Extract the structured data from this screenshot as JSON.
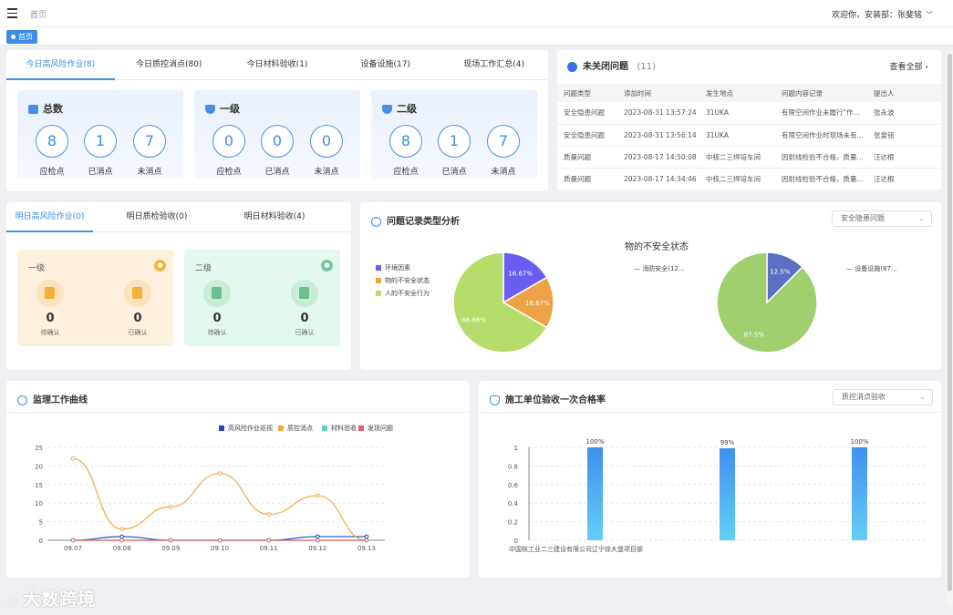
{
  "header": {
    "breadcrumb": "首页",
    "welcome": "欢迎你，安装部：张斐铭",
    "chevron": "﹀"
  },
  "tagbar": {
    "tag": "首页"
  },
  "today": {
    "tabs": [
      "今日高风险作业(8)",
      "今日质控消点(80)",
      "今日材料验收(1)",
      "设备设施(17)",
      "现场工作汇总(4)"
    ],
    "boxes": [
      {
        "title": "总数",
        "items": [
          {
            "value": "8",
            "label": "应检点"
          },
          {
            "value": "1",
            "label": "已消点"
          },
          {
            "value": "7",
            "label": "未消点"
          }
        ]
      },
      {
        "title": "一级",
        "items": [
          {
            "value": "0",
            "label": "应检点"
          },
          {
            "value": "0",
            "label": "已消点"
          },
          {
            "value": "0",
            "label": "未消点"
          }
        ]
      },
      {
        "title": "二级",
        "items": [
          {
            "value": "8",
            "label": "应检点"
          },
          {
            "value": "1",
            "label": "已消点"
          },
          {
            "value": "7",
            "label": "未消点"
          }
        ]
      }
    ]
  },
  "issues": {
    "title": "未关闭问题",
    "count": "(11)",
    "view_all": "查看全部",
    "view_all_arrow": "›",
    "columns": [
      "问题类型",
      "添加时间",
      "发生地点",
      "问题内容记录",
      "提出人"
    ],
    "rows": [
      [
        "安全隐患问题",
        "2023-08-31 13:57:24",
        "31UKA",
        "有限空间作业未履行\"作...",
        "张永波"
      ],
      [
        "安全隐患问题",
        "2023-08-31 13:56:14",
        "31UKA",
        "有限空间作业时现场未有...",
        "张斐铭"
      ],
      [
        "质量问题",
        "2023-08-17 14:50:08",
        "中核二三焊培车间",
        "因射线检验不合格，质量...",
        "汪达根"
      ],
      [
        "质量问题",
        "2023-08-17 14:34:46",
        "中核二三焊培车间",
        "因射线检验不合格，质量...",
        "汪达根"
      ]
    ]
  },
  "tomorrow": {
    "tabs": [
      "明日高风险作业(0)",
      "明日质检验收(0)",
      "明日材料验收(4)"
    ],
    "boxes": [
      {
        "title": "一级",
        "items": [
          {
            "value": "0",
            "label": "待确认"
          },
          {
            "value": "0",
            "label": "已确认"
          }
        ]
      },
      {
        "title": "二级",
        "items": [
          {
            "value": "0",
            "label": "待确认"
          },
          {
            "value": "0",
            "label": "已确认"
          }
        ]
      }
    ]
  },
  "issue_types": {
    "title": "问题记录类型分析",
    "select": "安全隐患问题",
    "subtitle": "物的不安全状态",
    "legend": [
      "环境因素",
      "物的不安全状态",
      "人的不安全行为"
    ],
    "pie1_labels": [
      "16.67%",
      "16.67%",
      "66.66%"
    ],
    "pie2_legend": [
      "消防安全(12...",
      "设备设施(87..."
    ],
    "pie2_labels": [
      "12.5%",
      "87.5%"
    ],
    "colors": {
      "env": "#6a5ef2",
      "obj": "#eea246",
      "human": "#b6dc6c",
      "fire": "#5b70c2",
      "equip": "#a0cf70"
    }
  },
  "supervision": {
    "title": "监理工作曲线",
    "legend": [
      "高风险作业巡视",
      "质控消点",
      "材料验收",
      "发现问题"
    ],
    "yticks": [
      "25",
      "20",
      "15",
      "10",
      "5",
      "0"
    ],
    "xticks": [
      "09.07",
      "09.08",
      "09.09",
      "09.10",
      "09.11",
      "09.12",
      "09.13"
    ]
  },
  "pass_rate": {
    "title": "施工单位验收一次合格率",
    "select": "质控消点验收",
    "yticks": [
      "1",
      "0.8",
      "0.6",
      "0.4",
      "0.2",
      "0"
    ],
    "bar_labels": [
      "100%",
      "99%",
      "100%"
    ],
    "xlabel": "中国核工业二三建设有限公司辽宁徐大堡项目部"
  },
  "chart_data": [
    {
      "type": "pie",
      "title": "问题记录类型分析",
      "categories": [
        "环境因素",
        "物的不安全状态",
        "人的不安全行为"
      ],
      "values": [
        16.67,
        16.67,
        66.66
      ]
    },
    {
      "type": "pie",
      "title": "物的不安全状态",
      "categories": [
        "消防安全",
        "设备设施"
      ],
      "values": [
        12.5,
        87.5
      ]
    },
    {
      "type": "line",
      "title": "监理工作曲线",
      "x": [
        "09.07",
        "09.08",
        "09.09",
        "09.10",
        "09.11",
        "09.12",
        "09.13"
      ],
      "ylim": [
        0,
        25
      ],
      "series": [
        {
          "name": "高风险作业巡视",
          "color": "#2145c8",
          "values": [
            0,
            1,
            0,
            0,
            0,
            1,
            1
          ]
        },
        {
          "name": "质控消点",
          "color": "#eeaa44",
          "values": [
            22,
            3,
            9,
            18,
            7,
            12,
            0
          ]
        },
        {
          "name": "材料验收",
          "color": "#5fd0d0",
          "values": [
            0,
            0,
            0,
            0,
            0,
            0,
            0
          ]
        },
        {
          "name": "发现问题",
          "color": "#e86060",
          "values": [
            0,
            0,
            0,
            0,
            0,
            0,
            0
          ]
        }
      ]
    },
    {
      "type": "bar",
      "title": "施工单位验收一次合格率",
      "categories": [
        "",
        "",
        ""
      ],
      "values": [
        1,
        0.99,
        1
      ],
      "ylim": [
        0,
        1
      ]
    }
  ],
  "watermark": "大数跨境"
}
